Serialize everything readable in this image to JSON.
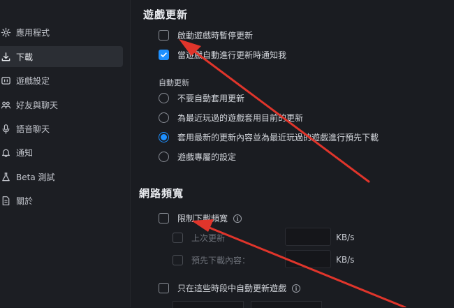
{
  "sidebar": {
    "items": [
      {
        "label": "應用程式",
        "icon": "gear-icon",
        "active": false
      },
      {
        "label": "下載",
        "icon": "download-icon",
        "active": true
      },
      {
        "label": "遊戲設定",
        "icon": "gamepad-icon",
        "active": false
      },
      {
        "label": "好友與聊天",
        "icon": "friends-icon",
        "active": false
      },
      {
        "label": "語音聊天",
        "icon": "microphone-icon",
        "active": false
      },
      {
        "label": "通知",
        "icon": "bell-icon",
        "active": false
      },
      {
        "label": "Beta 測試",
        "icon": "flask-icon",
        "active": false
      },
      {
        "label": "關於",
        "icon": "document-icon",
        "active": false
      }
    ]
  },
  "game_updates": {
    "title": "遊戲更新",
    "pause_on_launch": {
      "label": "啟動遊戲時暫停更新",
      "checked": false
    },
    "notify_on_auto_update": {
      "label": "當遊戲自動進行更新時通知我",
      "checked": true
    },
    "auto_update_title": "自動更新",
    "options": [
      {
        "label": "不要自動套用更新",
        "selected": false
      },
      {
        "label": "為最近玩過的遊戲套用目前的更新",
        "selected": false
      },
      {
        "label": "套用最新的更新內容並為最近玩過的遊戲進行預先下載",
        "selected": true
      },
      {
        "label": "遊戲專屬的設定",
        "selected": false
      }
    ]
  },
  "network_bandwidth": {
    "title": "網路頻寬",
    "limit_download": {
      "label": "限制下載頻寬",
      "checked": false
    },
    "last_update": {
      "label": "上次更新",
      "unit": "KB/s"
    },
    "predownload": {
      "label": "預先下載內容：",
      "unit": "KB/s"
    },
    "schedule": {
      "label": "只在這些時段中自動更新遊戲",
      "checked": false
    }
  },
  "colors": {
    "accent": "#1e90ff",
    "arrow": "#e0352b",
    "background": "#1a1c21"
  }
}
